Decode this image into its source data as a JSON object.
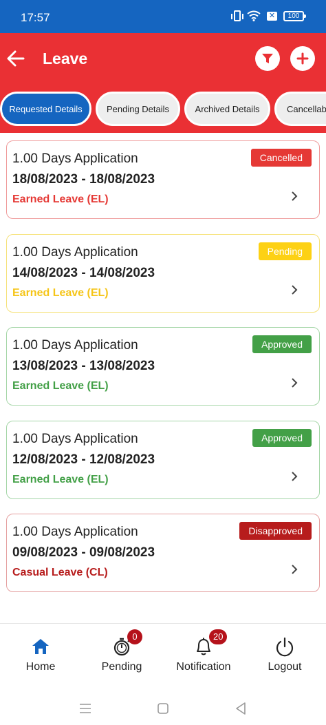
{
  "status_bar": {
    "time": "17:57",
    "battery": "100"
  },
  "header": {
    "title": "Leave"
  },
  "tabs": [
    {
      "label": "Requested Details",
      "active": true
    },
    {
      "label": "Pending Details",
      "active": false
    },
    {
      "label": "Archived Details",
      "active": false
    },
    {
      "label": "Cancellable",
      "active": false
    }
  ],
  "applications": [
    {
      "title": "1.00 Days Application",
      "dates": "18/08/2023 - 18/08/2023",
      "leave_type": "Earned Leave (EL)",
      "status": "Cancelled",
      "status_color": "#e53935",
      "border_color": "#ef9a9a",
      "type_color": "#e53935"
    },
    {
      "title": "1.00 Days Application",
      "dates": "14/08/2023 - 14/08/2023",
      "leave_type": "Earned Leave (EL)",
      "status": "Pending",
      "status_color": "#fdd114",
      "border_color": "#f6e27a",
      "type_color": "#f5c518"
    },
    {
      "title": "1.00 Days Application",
      "dates": "13/08/2023 - 13/08/2023",
      "leave_type": "Earned Leave (EL)",
      "status": "Approved",
      "status_color": "#43a047",
      "border_color": "#a5d6a7",
      "type_color": "#43a047"
    },
    {
      "title": "1.00 Days Application",
      "dates": "12/08/2023 - 12/08/2023",
      "leave_type": "Earned Leave (EL)",
      "status": "Approved",
      "status_color": "#43a047",
      "border_color": "#a5d6a7",
      "type_color": "#43a047"
    },
    {
      "title": "1.00 Days Application",
      "dates": "09/08/2023 - 09/08/2023",
      "leave_type": "Casual Leave (CL)",
      "status": "Disapproved",
      "status_color": "#b71c1c",
      "border_color": "#e5a0a0",
      "type_color": "#b71c1c"
    }
  ],
  "bottom_nav": [
    {
      "label": "Home",
      "icon": "home-icon"
    },
    {
      "label": "Pending",
      "icon": "timer-icon",
      "badge": "0"
    },
    {
      "label": "Notification",
      "icon": "bell-icon",
      "badge": "20"
    },
    {
      "label": "Logout",
      "icon": "power-icon"
    }
  ],
  "colors": {
    "header": "#ea3034",
    "status_bar": "#1565c0",
    "active_tab": "#1565c0",
    "home_active": "#1565c0"
  }
}
